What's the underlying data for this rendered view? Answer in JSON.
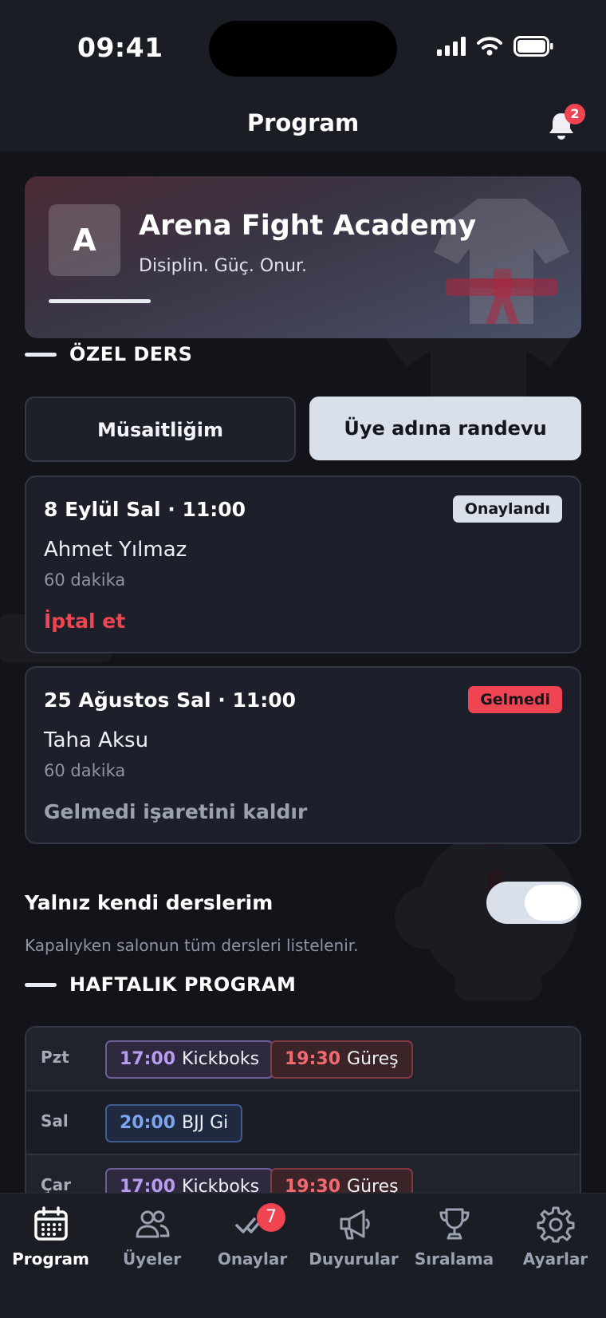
{
  "status_bar": {
    "time": "09:41"
  },
  "header": {
    "title": "Program",
    "notification_count": "2"
  },
  "gym": {
    "initial": "A",
    "name": "Arena Fight Academy",
    "tagline": "Disiplin. Güç. Onur."
  },
  "private_lessons": {
    "section_title": "ÖZEL DERS",
    "tabs": [
      {
        "label": "Müsaitliğim",
        "selected": false
      },
      {
        "label": "Üye adına randevu",
        "selected": true
      }
    ],
    "appointments": [
      {
        "date": "8 Eylül Sal · 11:00",
        "status": "Onaylandı",
        "member": "Ahmet Yılmaz",
        "duration": "60 dakika",
        "action": "İptal et"
      },
      {
        "date": "25 Ağustos Sal · 11:00",
        "status": "Gelmedi",
        "member": "Taha Aksu",
        "duration": "60 dakika",
        "action": "Gelmedi işaretini kaldır"
      }
    ]
  },
  "filter": {
    "label": "Yalnız kendi derslerim",
    "enabled": true,
    "hint": "Kapalıyken salonun tüm dersleri listelenir."
  },
  "weekly": {
    "section_title": "HAFTALIK PROGRAM",
    "rows": [
      {
        "day": "Pzt",
        "classes": [
          {
            "time": "17:00",
            "name": "Kickboks"
          },
          {
            "time": "19:30",
            "name": "Güreş"
          }
        ]
      },
      {
        "day": "Sal",
        "classes": [
          {
            "time": "20:00",
            "name": "BJJ Gi"
          }
        ]
      },
      {
        "day": "Çar",
        "classes": [
          {
            "time": "17:00",
            "name": "Kickboks"
          },
          {
            "time": "19:30",
            "name": "Güreş"
          }
        ]
      }
    ]
  },
  "tabbar": {
    "items": [
      {
        "label": "Program",
        "icon": "calendar-icon",
        "active": true
      },
      {
        "label": "Üyeler",
        "icon": "users-icon",
        "active": false
      },
      {
        "label": "Onaylar",
        "icon": "double-check-icon",
        "active": false,
        "badge": "7"
      },
      {
        "label": "Duyurular",
        "icon": "megaphone-icon",
        "active": false
      },
      {
        "label": "Sıralama",
        "icon": "trophy-icon",
        "active": false
      },
      {
        "label": "Ayarlar",
        "icon": "gear-icon",
        "active": false
      }
    ]
  },
  "colors": {
    "accent": "#d9e0ea",
    "danger": "#ef4552",
    "background": "#121419",
    "surface": "#1d202a"
  }
}
